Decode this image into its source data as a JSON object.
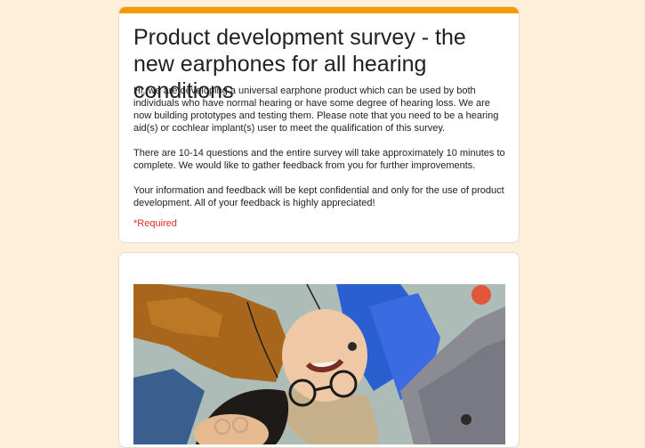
{
  "form": {
    "accent_color": "#f29a00",
    "background_color": "#fdefd9",
    "title": "Product development survey - the new earphones for all hearing conditions",
    "description": [
      "Hi, we are developing a universal earphone product which can be used by both individuals who have normal hearing or have some degree of hearing loss. We are now building prototypes and testing them. Please note that you need to be a hearing aid(s) or cochlear implant(s) user to meet the qualification of this survey.",
      "There are 10-14 questions and the entire survey will take approximately 10 minutes to complete. We would like to gather feedback from you for further improvements.",
      "Your information and feedback will be kept confidential and only for the use of product development. All of your feedback is highly appreciated!"
    ],
    "required_note": "*Required",
    "required_color": "#d93025"
  },
  "image_section": {
    "image_alt": "people-lying-on-rug-with-earphones-photo"
  }
}
